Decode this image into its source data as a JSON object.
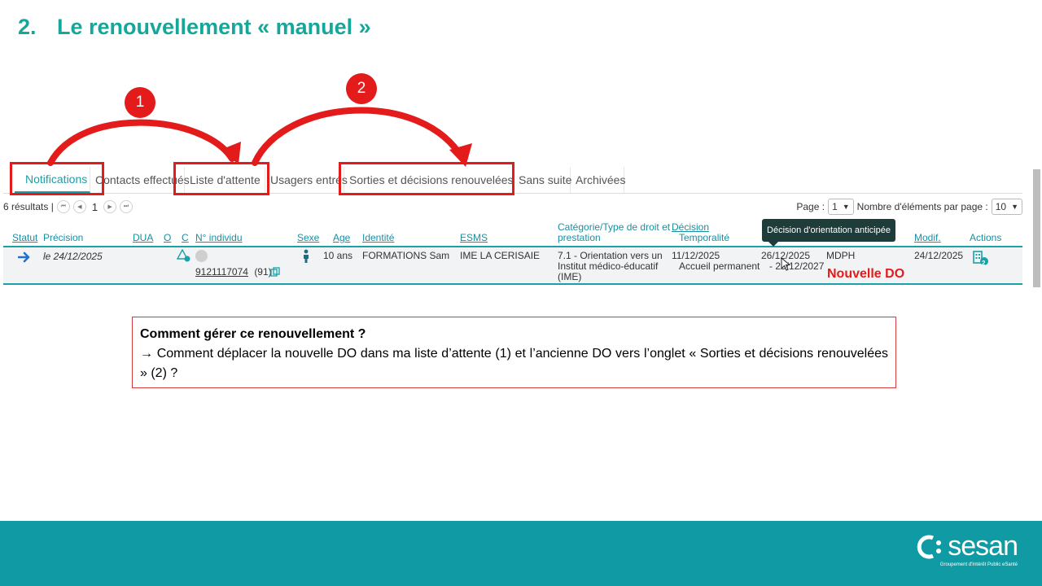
{
  "slide": {
    "number": "2.",
    "title": "Le renouvellement « manuel »"
  },
  "annotations": {
    "badge1": "1",
    "badge2": "2",
    "new_do": "Nouvelle DO"
  },
  "tabs": [
    {
      "label": "Notifications"
    },
    {
      "label": "Contacts effectués"
    },
    {
      "label": "Liste d'attente"
    },
    {
      "label": "Usagers entrés"
    },
    {
      "label": "Sorties et décisions renouvelées"
    },
    {
      "label": "Sans suite"
    },
    {
      "label": "Archivées"
    }
  ],
  "results": {
    "count_label": "6 résultats |",
    "first": "⏮",
    "prev": "◀",
    "current": "1",
    "next": "▶",
    "last": "⏭"
  },
  "page_ctrl": {
    "page_label": "Page :",
    "page_value": "1",
    "per_page_label": "Nombre d'éléments par page :",
    "per_page_value": "10"
  },
  "columns": {
    "statut": "Statut",
    "precision": "Précision",
    "dua": "DUA",
    "o": "O",
    "c": "C",
    "individu": "N° individu",
    "sexe": "Sexe",
    "age": "Age",
    "identite": "Identité",
    "esms": "ESMS",
    "categorie_1": "Catégorie/Type de droit et",
    "categorie_2": "prestation",
    "decision_1": "Décision",
    "decision_2": "Temporalité",
    "modif": "Modif.",
    "actions": "Actions"
  },
  "tooltip": "Décision d'orientation anticipée",
  "row": {
    "precision": "le 24/12/2025",
    "individu": "9121117074",
    "individu_dept": "(91)",
    "age": "10 ans",
    "identite": "FORMATIONS Sam",
    "esms": "IME LA CERISAIE",
    "categorie_1": "7.1 - Orientation vers un",
    "categorie_2": "Institut médico-éducatif",
    "categorie_3": "(IME)",
    "decision_date": "11/12/2025",
    "decision_temp": "Accueil permanent",
    "date_start": "26/12/2025",
    "date_end": "- 25/12/2027",
    "source": "MDPH",
    "modif": "24/12/2025",
    "actions_badge": "2"
  },
  "question": {
    "title": "Comment gérer ce renouvellement ?",
    "arrow": "→",
    "text": "Comment déplacer la nouvelle DO dans ma liste d’attente (1) et l’ancienne DO vers l’onglet « Sorties et décisions renouvelées  » (2) ?"
  },
  "footer": {
    "brand": "sesan",
    "tagline": "Groupement d'Intérêt Public eSanté"
  },
  "colors": {
    "accent": "#15a89a",
    "annotation_red": "#e31b1b",
    "footer": "#0f9aa4",
    "tab_active": "#1a9ea6"
  }
}
